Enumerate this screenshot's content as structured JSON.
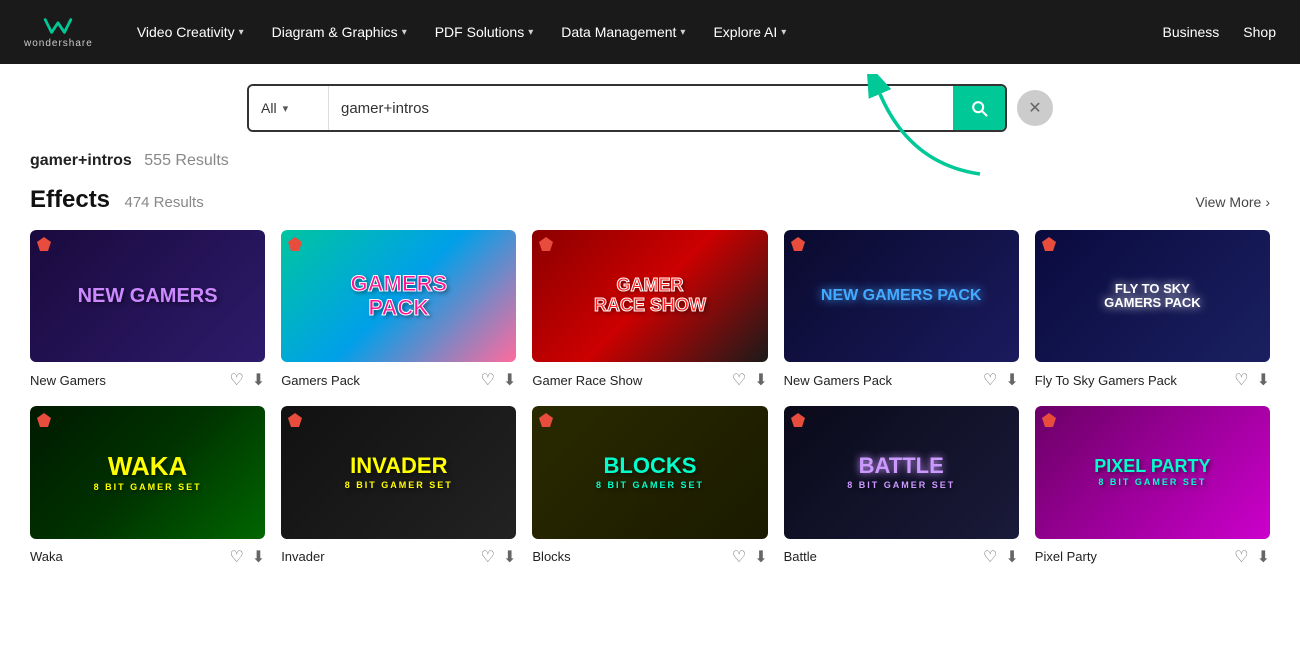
{
  "brand": {
    "name": "wondershare",
    "logo_unicode": "W"
  },
  "nav": {
    "items": [
      {
        "label": "Video Creativity",
        "has_dropdown": true
      },
      {
        "label": "Diagram & Graphics",
        "has_dropdown": true
      },
      {
        "label": "PDF Solutions",
        "has_dropdown": true
      },
      {
        "label": "Data Management",
        "has_dropdown": true
      },
      {
        "label": "Explore AI",
        "has_dropdown": true
      }
    ],
    "right_items": [
      {
        "label": "Business"
      },
      {
        "label": "Shop"
      }
    ]
  },
  "search": {
    "category_label": "All",
    "query": "gamer+intros",
    "search_button_aria": "search"
  },
  "results": {
    "query_display": "gamer+intros",
    "total_results": "555 Results"
  },
  "effects_section": {
    "title": "Effects",
    "count": "474 Results",
    "view_more": "View More",
    "cards": [
      {
        "title": "New Gamers",
        "thumb_class": "thumb-1",
        "text": "New Gamers",
        "text_class": "purple"
      },
      {
        "title": "Gamers Pack",
        "thumb_class": "thumb-2",
        "text": "GAMERS PACK",
        "text_class": "pink"
      },
      {
        "title": "Gamer Race Show",
        "thumb_class": "thumb-3",
        "text": "GAMER RACE SHOW",
        "text_class": "red"
      },
      {
        "title": "New Gamers Pack",
        "thumb_class": "thumb-4",
        "text": "New Gamers Pack",
        "text_class": "blue-glow"
      },
      {
        "title": "Fly To Sky Gamers Pack",
        "thumb_class": "thumb-5",
        "text": "FLY TO SKY GAMERS PACK",
        "text_class": "white-glow"
      }
    ],
    "row2_cards": [
      {
        "title": "Waka 8 Bit Gamer Set",
        "thumb_class": "thumb-6",
        "text": "WAKA",
        "sub": "8 BIT GAMER SET",
        "text_class": "yellow"
      },
      {
        "title": "Invader 8 Bit Gamer Set",
        "thumb_class": "thumb-7",
        "text": "INVADER",
        "sub": "8 BIT GAMER SET",
        "text_class": "yellow"
      },
      {
        "title": "Blocks 8 Bit Gamer Set",
        "thumb_class": "thumb-8",
        "text": "BLOCKS",
        "sub": "8 BIT GAMER SET",
        "text_class": "cyan"
      },
      {
        "title": "Battle 8 Bit Gamer Set",
        "thumb_class": "thumb-9",
        "text": "BATTLE",
        "sub": "8 BIT GAMER SET",
        "text_class": "yellow"
      },
      {
        "title": "Pixel Party 8 Bit Gamer Set",
        "thumb_class": "thumb-10",
        "text": "PIXEL PARTY",
        "sub": "8 BIT GAMER SET",
        "text_class": "cyan"
      }
    ]
  }
}
